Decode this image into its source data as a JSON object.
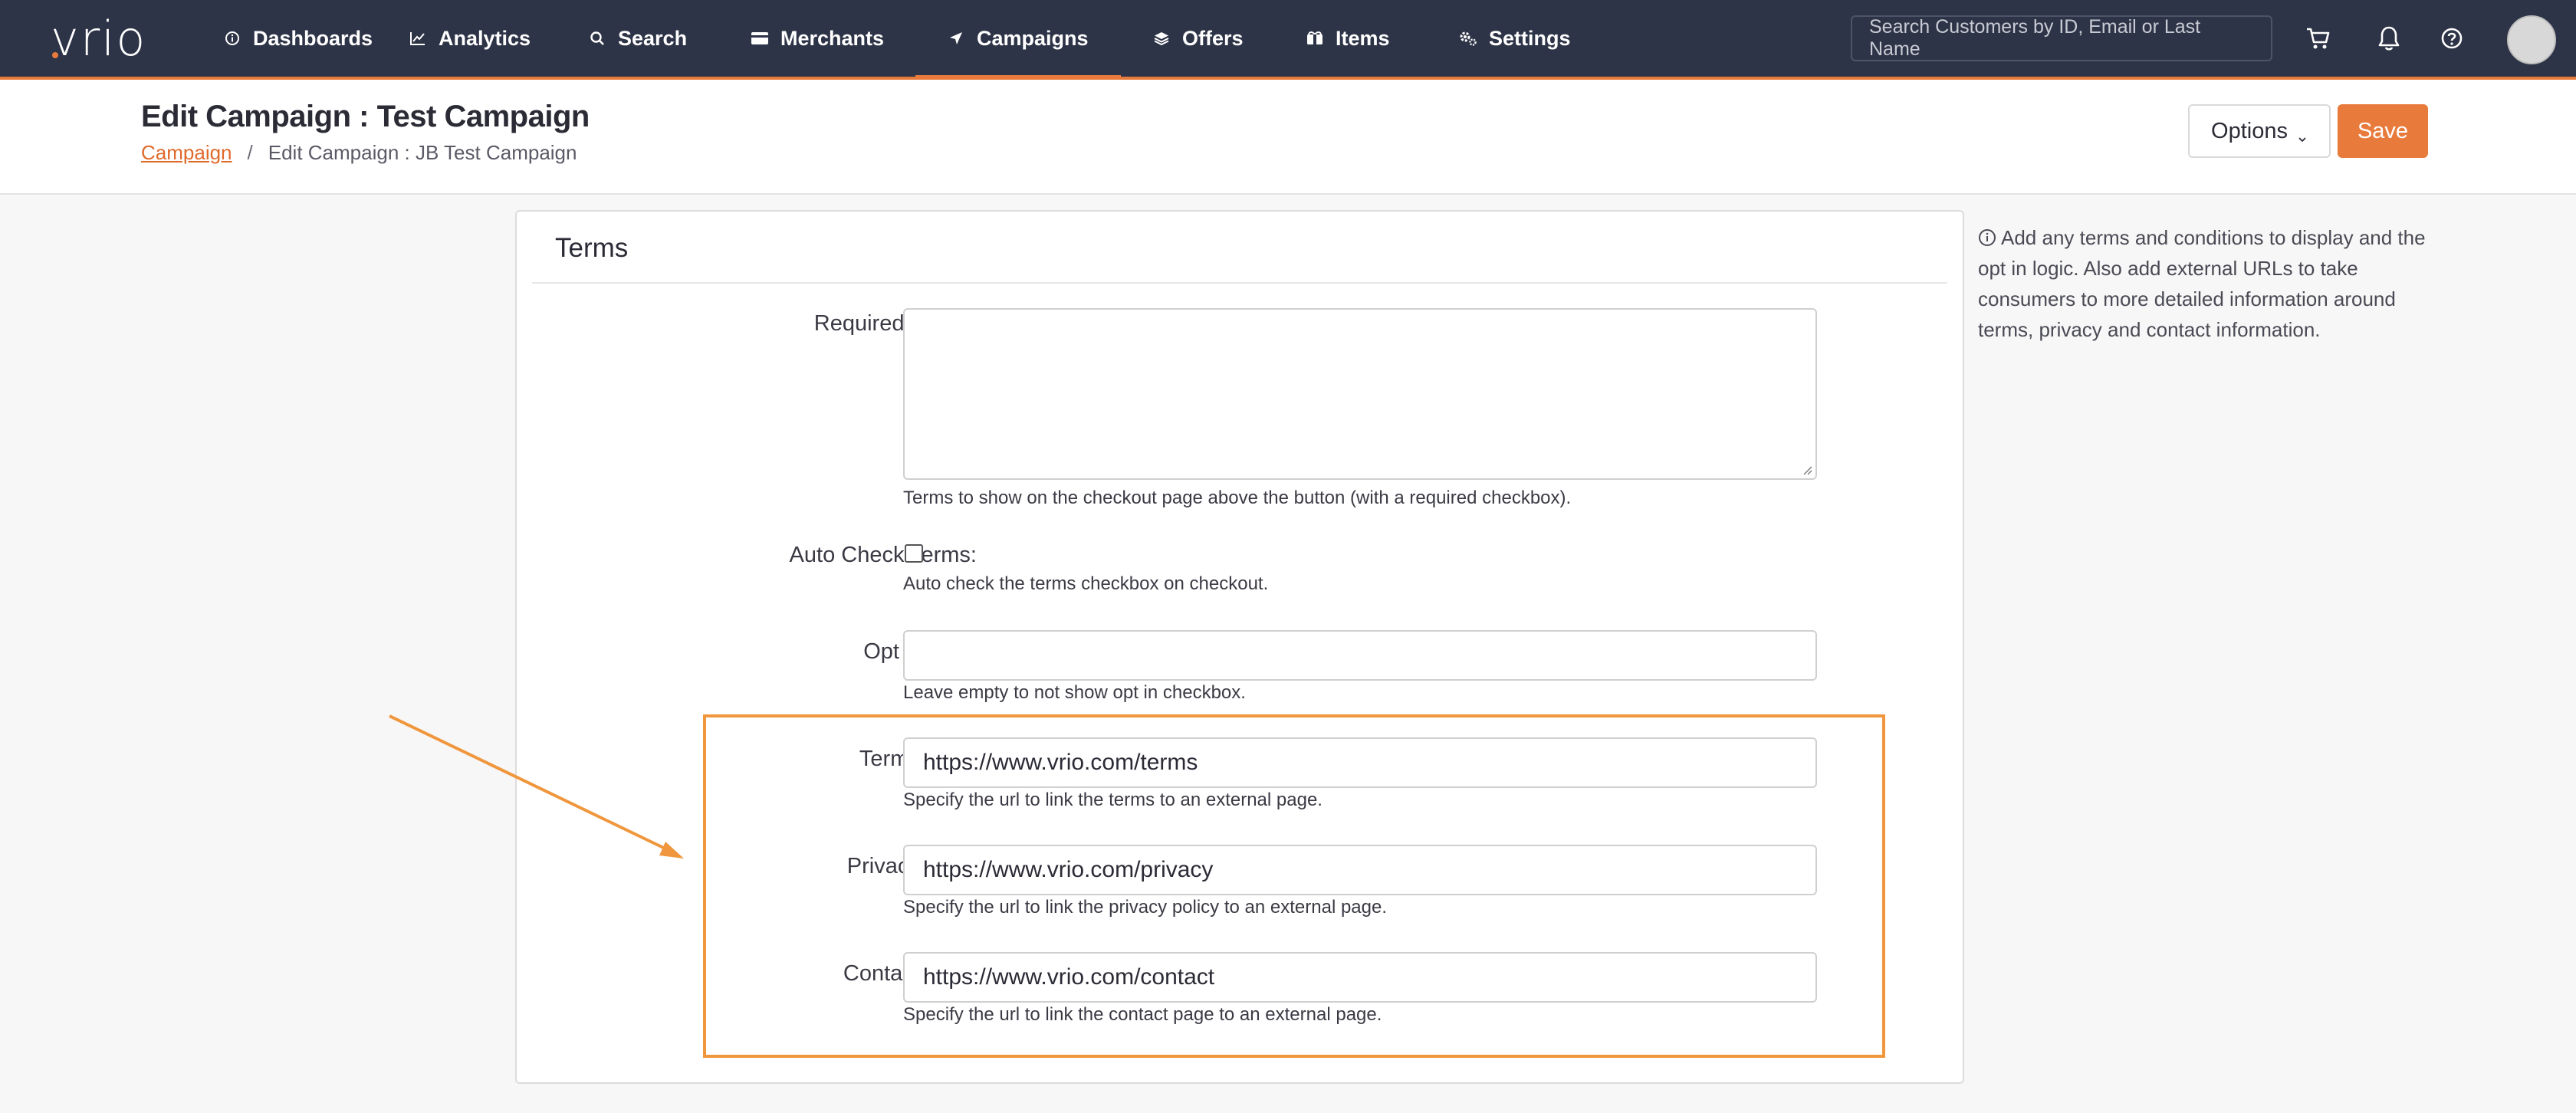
{
  "nav": {
    "logo": "vrio",
    "items": [
      {
        "label": "Dashboards",
        "icon": "info-circle-icon"
      },
      {
        "label": "Analytics",
        "icon": "line-chart-icon"
      },
      {
        "label": "Search",
        "icon": "search-icon"
      },
      {
        "label": "Merchants",
        "icon": "credit-card-icon"
      },
      {
        "label": "Campaigns",
        "icon": "paper-plane-icon",
        "active": true
      },
      {
        "label": "Offers",
        "icon": "layers-icon"
      },
      {
        "label": "Items",
        "icon": "box-icon"
      },
      {
        "label": "Settings",
        "icon": "gears-icon"
      }
    ],
    "search_placeholder": "Search Customers by ID, Email or Last Name",
    "accent": "#e87b3c",
    "background": "#2e3447"
  },
  "header": {
    "title": "Edit Campaign : Test Campaign",
    "breadcrumb": {
      "link": "Campaign",
      "separator": "/",
      "current": "Edit Campaign : JB Test Campaign"
    },
    "options_label": "Options",
    "save_label": "Save"
  },
  "terms": {
    "section_title": "Terms",
    "required_terms": {
      "label": "Required Terms:",
      "value": "",
      "help": "Terms to show on the checkout page above the button (with a required checkbox)."
    },
    "auto_check": {
      "label": "Auto Check Terms:",
      "checked": false,
      "help": "Auto check the terms checkbox on checkout."
    },
    "opt_in": {
      "label": "Opt In Text:",
      "value": "",
      "help": "Leave empty to not show opt in checkbox."
    },
    "terms_url": {
      "label": "Terms URL:",
      "value": "https://www.vrio.com/terms",
      "help": "Specify the url to link the terms to an external page."
    },
    "privacy_url": {
      "label": "Privacy URL:",
      "value": "https://www.vrio.com/privacy",
      "help": "Specify the url to link the privacy policy to an external page."
    },
    "contact_url": {
      "label": "Contact URL:",
      "value": "https://www.vrio.com/contact",
      "help": "Specify the url to link the contact page to an external page."
    }
  },
  "info": {
    "text": "Add any terms and conditions to display and the opt in logic. Also add external URLs to take consumers to more detailed information around terms, privacy and contact information."
  },
  "annotation": {
    "highlight_color": "#f0963c"
  }
}
